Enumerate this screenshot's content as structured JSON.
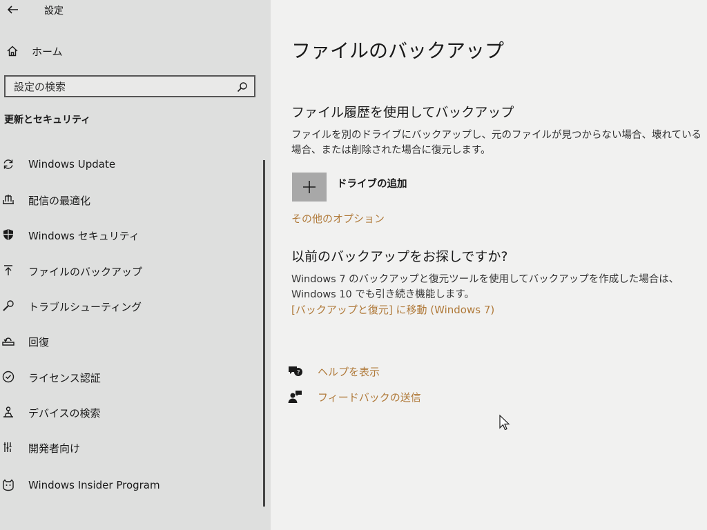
{
  "window": {
    "title": "設定"
  },
  "sidebar": {
    "home_label": "ホーム",
    "search": {
      "placeholder": "設定の検索"
    },
    "section_title": "更新とセキュリティ",
    "items": [
      {
        "label": "Windows Update",
        "icon": "sync-icon"
      },
      {
        "label": "配信の最適化",
        "icon": "delivery-optimization-icon"
      },
      {
        "label": "Windows セキュリティ",
        "icon": "shield-icon"
      },
      {
        "label": "ファイルのバックアップ",
        "icon": "backup-arrow-icon"
      },
      {
        "label": "トラブルシューティング",
        "icon": "wrench-icon"
      },
      {
        "label": "回復",
        "icon": "recovery-icon"
      },
      {
        "label": "ライセンス認証",
        "icon": "checkmark-circle-icon"
      },
      {
        "label": "デバイスの検索",
        "icon": "find-device-icon"
      },
      {
        "label": "開発者向け",
        "icon": "developer-tools-icon"
      },
      {
        "label": "Windows Insider Program",
        "icon": "insider-cat-icon"
      }
    ]
  },
  "main": {
    "title": "ファイルのバックアップ",
    "file_history": {
      "heading": "ファイル履歴を使用してバックアップ",
      "description": "ファイルを別のドライブにバックアップし、元のファイルが見つからない場合、壊れている場合、または削除された場合に復元します。",
      "add_drive_label": "ドライブの追加",
      "more_options_link": "その他のオプション"
    },
    "older_backup": {
      "heading": "以前のバックアップをお探しですか?",
      "description": "Windows 7 のバックアップと復元ツールを使用してバックアップを作成した場合は、Windows 10 でも引き続き機能します。",
      "link": "[バックアップと復元] に移動 (Windows 7)"
    },
    "help_link": "ヘルプを表示",
    "feedback_link": "フィードバックの送信"
  },
  "colors": {
    "link": "#b07a3a",
    "sidebar_bg": "#dedfde",
    "main_bg": "#f1f1f0",
    "add_tile": "#a8a8a8"
  }
}
